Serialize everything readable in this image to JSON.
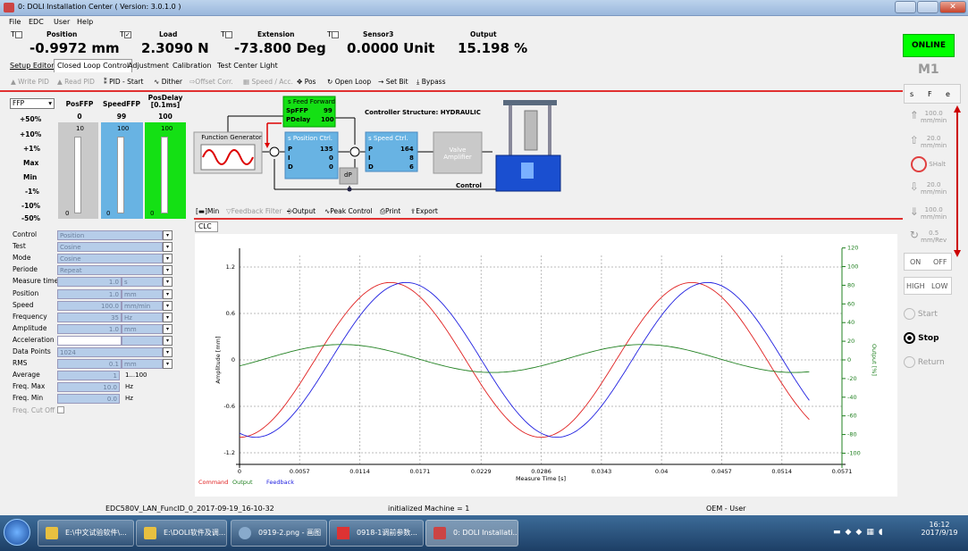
{
  "window": {
    "title": "0: DOLI Installation Center ( Version: 3.0.1.0 )"
  },
  "menu": [
    "File",
    "EDC",
    "User",
    "Help"
  ],
  "readouts": [
    {
      "label": "Position",
      "value": "-0.9972 mm",
      "t": "T"
    },
    {
      "label": "Load",
      "value": "2.3090 N",
      "t": "T"
    },
    {
      "label": "Extension",
      "value": "-73.800 Deg",
      "t": "T"
    },
    {
      "label": "Sensor3",
      "value": "0.0000 Unit",
      "t": "T"
    },
    {
      "label": "Output",
      "value": "15.198 %",
      "t": ""
    }
  ],
  "status": {
    "online": "ONLINE",
    "machine": "M1"
  },
  "tabs": [
    "Setup Editor",
    "Closed Loop Control",
    "Adjustment",
    "Calibration",
    "Test Center Light"
  ],
  "toolbar": [
    "Write PID",
    "Read PID",
    "PID - Start",
    "Dither",
    "Offset Corr.",
    "Speed / Acc.",
    "Pos",
    "Open Loop",
    "Set Bit",
    "Bypass"
  ],
  "ffp": {
    "select": "FFP",
    "heads": [
      "PosFFP",
      "SpeedFFP",
      "PosDelay\n[0.1ms]"
    ],
    "values": [
      "0",
      "99",
      "100"
    ],
    "scale_top": [
      "10",
      "100",
      "100"
    ],
    "scale_bottom": [
      "0",
      "0",
      "0"
    ],
    "levels": [
      "+50%",
      "+10%",
      "+1%",
      "Max",
      "Min",
      "-1%",
      "-10%",
      "-50%"
    ]
  },
  "diagram": {
    "function_generator": "Function Generator",
    "ff_title": "s Feed Forward",
    "spffp_lbl": "SpFFP",
    "spffp_val": "99",
    "pdelay_lbl": "PDelay",
    "pdelay_val": "100",
    "pos_title": "s Position Ctrl.",
    "pos_p": "135",
    "pos_i": "0",
    "pos_d": "0",
    "speed_title": "s Speed Ctrl.",
    "spd_p": "164",
    "spd_i": "8",
    "spd_d": "6",
    "valve": "Valve\nAmplifier",
    "dp": "dP",
    "structure": "Controller Structure: HYDRAULIC",
    "control": "Control",
    "p": "P",
    "i": "I",
    "d": "D"
  },
  "subtoolbar": [
    "Min",
    "Feedback Filter",
    "Output",
    "Peak Control",
    "Print",
    "Export"
  ],
  "clc_tab": "CLC",
  "form": [
    {
      "label": "Control",
      "value": "Position",
      "dd": true
    },
    {
      "label": "Test",
      "value": "Cosine",
      "dd": true
    },
    {
      "label": "Mode",
      "value": "Cosine",
      "dd": true
    },
    {
      "label": "Periode",
      "value": "Repeat",
      "dd": true
    },
    {
      "label": "Measure time",
      "value": "1.0",
      "unit": "s",
      "dd": true
    },
    {
      "label": "Position",
      "value": "1.0",
      "unit": "mm",
      "dd": true
    },
    {
      "label": "Speed",
      "value": "100.0",
      "unit": "mm/min",
      "dd": true
    },
    {
      "label": "Frequency",
      "value": "35",
      "unit": "Hz",
      "dd": true
    },
    {
      "label": "Amplitude",
      "value": "1.0",
      "unit": "mm",
      "dd": true
    },
    {
      "label": "Acceleration",
      "value": "",
      "unit": "",
      "dd": true
    },
    {
      "label": "Data Points",
      "value": "1024",
      "dd": true
    },
    {
      "label": "RMS",
      "value": "0.1",
      "unit": "mm",
      "dd": true
    },
    {
      "label": "Average",
      "value": "1",
      "unit": "1...100"
    },
    {
      "label": "Freq. Max",
      "value": "10.0",
      "unit": "Hz"
    },
    {
      "label": "Freq. Min",
      "value": "0.0",
      "unit": "Hz"
    },
    {
      "label": "Freq. Cut Off",
      "value": ""
    }
  ],
  "right": {
    "tabs": [
      "s",
      "F",
      "e"
    ],
    "speeds": [
      "100.0\nmm/min",
      "20.0\nmm/min",
      "SHalt",
      "20.0\nmm/min",
      "100.0\nmm/min",
      "0.5\nmm/Rev"
    ],
    "on": "ON",
    "off": "OFF",
    "high": "HIGH",
    "low": "LOW",
    "start": "Start",
    "stop": "Stop",
    "return": "Return"
  },
  "statusbar": {
    "left": "EDC580V_LAN_FuncID_0_2017-09-19_16-10-32",
    "mid": "initialized Machine = 1",
    "right": "OEM - User"
  },
  "taskbar": {
    "items": [
      "E:\\中文试验软件\\...",
      "E:\\DOLI软件及调...",
      "0919-2.png - 画图",
      "0918-1调前参数...",
      "0: DOLI Installati..."
    ],
    "time": "16:12",
    "date": "2017/9/19"
  },
  "chart_data": {
    "type": "line",
    "xlabel": "Measure Time [s]",
    "ylabel": "Amplitude [mm]",
    "y2label": "Output [%]",
    "xlim": [
      0,
      0.0571
    ],
    "ylim": [
      -1.35,
      1.35
    ],
    "y2lim": [
      -112,
      112
    ],
    "xticks": [
      "0",
      "0.0057",
      "0.0114",
      "0.0171",
      "0.0229",
      "0.0286",
      "0.0343",
      "0.04",
      "0.0457",
      "0.0514",
      "0.0571"
    ],
    "yticks": [
      "1.2",
      "0.6",
      "0",
      "-0.6",
      "-1.2"
    ],
    "y2ticks": [
      "120",
      "100",
      "80",
      "60",
      "40",
      "20",
      "0",
      "-20",
      "-40",
      "-60",
      "-80",
      "-100"
    ],
    "grid": true,
    "legend": [
      "Command",
      "Output",
      "Feedback"
    ],
    "colors": {
      "command": "#e02020",
      "output": "#208020",
      "feedback": "#2020e0"
    },
    "series": [
      {
        "name": "Command",
        "axis": "left",
        "x_end": 0.054,
        "amplitude": 1.0,
        "period": 0.02857,
        "phase_x": 0.0,
        "form": "-cos"
      },
      {
        "name": "Feedback",
        "axis": "left",
        "x_end": 0.054,
        "amplitude": 1.0,
        "period": 0.02857,
        "phase_x": 0.0015,
        "form": "-cos"
      },
      {
        "name": "Output",
        "axis": "right",
        "x_end": 0.054,
        "amplitude": 15.0,
        "period": 0.02857,
        "phase_x": -0.0046,
        "form": "-cos",
        "offset": 1.5
      }
    ]
  }
}
